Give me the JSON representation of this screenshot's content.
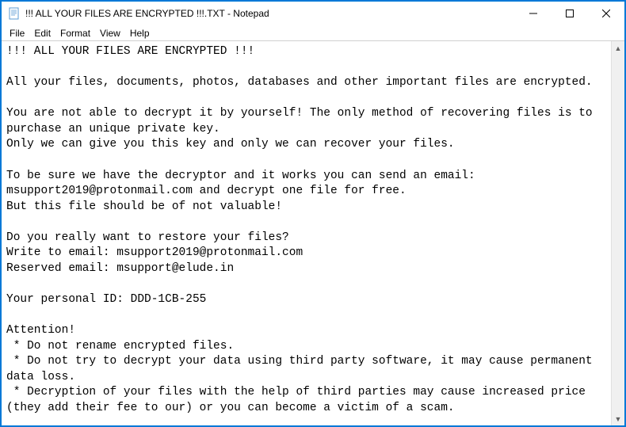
{
  "titlebar": {
    "title": "!!! ALL YOUR FILES ARE ENCRYPTED !!!.TXT - Notepad"
  },
  "menubar": {
    "file": "File",
    "edit": "Edit",
    "format": "Format",
    "view": "View",
    "help": "Help"
  },
  "content": {
    "text": "!!! ALL YOUR FILES ARE ENCRYPTED !!!\n\nAll your files, documents, photos, databases and other important files are encrypted.\n\nYou are not able to decrypt it by yourself! The only method of recovering files is to purchase an unique private key.\nOnly we can give you this key and only we can recover your files.\n\nTo be sure we have the decryptor and it works you can send an email: msupport2019@protonmail.com and decrypt one file for free.\nBut this file should be of not valuable!\n\nDo you really want to restore your files?\nWrite to email: msupport2019@protonmail.com\nReserved email: msupport@elude.in\n\nYour personal ID: DDD-1CB-255\n\nAttention!\n * Do not rename encrypted files.\n * Do not try to decrypt your data using third party software, it may cause permanent data loss.\n * Decryption of your files with the help of third parties may cause increased price (they add their fee to our) or you can become a victim of a scam."
  },
  "scrollbar": {
    "up": "▲",
    "down": "▼"
  }
}
